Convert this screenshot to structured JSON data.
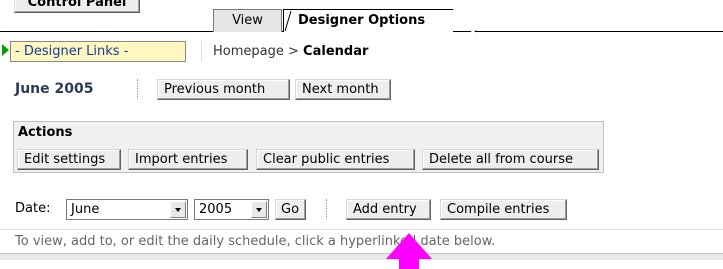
{
  "control_panel": {
    "label": "Control Panel"
  },
  "tabs": [
    {
      "label": "View"
    },
    {
      "label": "Designer Options"
    }
  ],
  "designer_links": {
    "label": "- Designer Links -"
  },
  "breadcrumb": {
    "home": "Homepage",
    "separator": ">",
    "current": "Calendar"
  },
  "month_nav": {
    "title": "June 2005",
    "previous_label": "Previous month",
    "next_label": "Next month"
  },
  "actions": {
    "heading": "Actions",
    "buttons": [
      {
        "label": "Edit settings"
      },
      {
        "label": "Import entries"
      },
      {
        "label": "Clear public entries"
      },
      {
        "label": "Delete all from course"
      }
    ]
  },
  "date_form": {
    "label": "Date:",
    "month_value": "June",
    "year_value": "2005",
    "go_label": "Go",
    "add_entry_label": "Add entry",
    "compile_label": "Compile entries"
  },
  "instructions": "To view, add to, or edit the daily schedule, click a hyperlinked date below.",
  "colors": {
    "arrow": "#ff00ff",
    "link_arrow": "#00a000",
    "links_bg": "#fff7c0",
    "actions_bg": "#f0f0f0"
  }
}
